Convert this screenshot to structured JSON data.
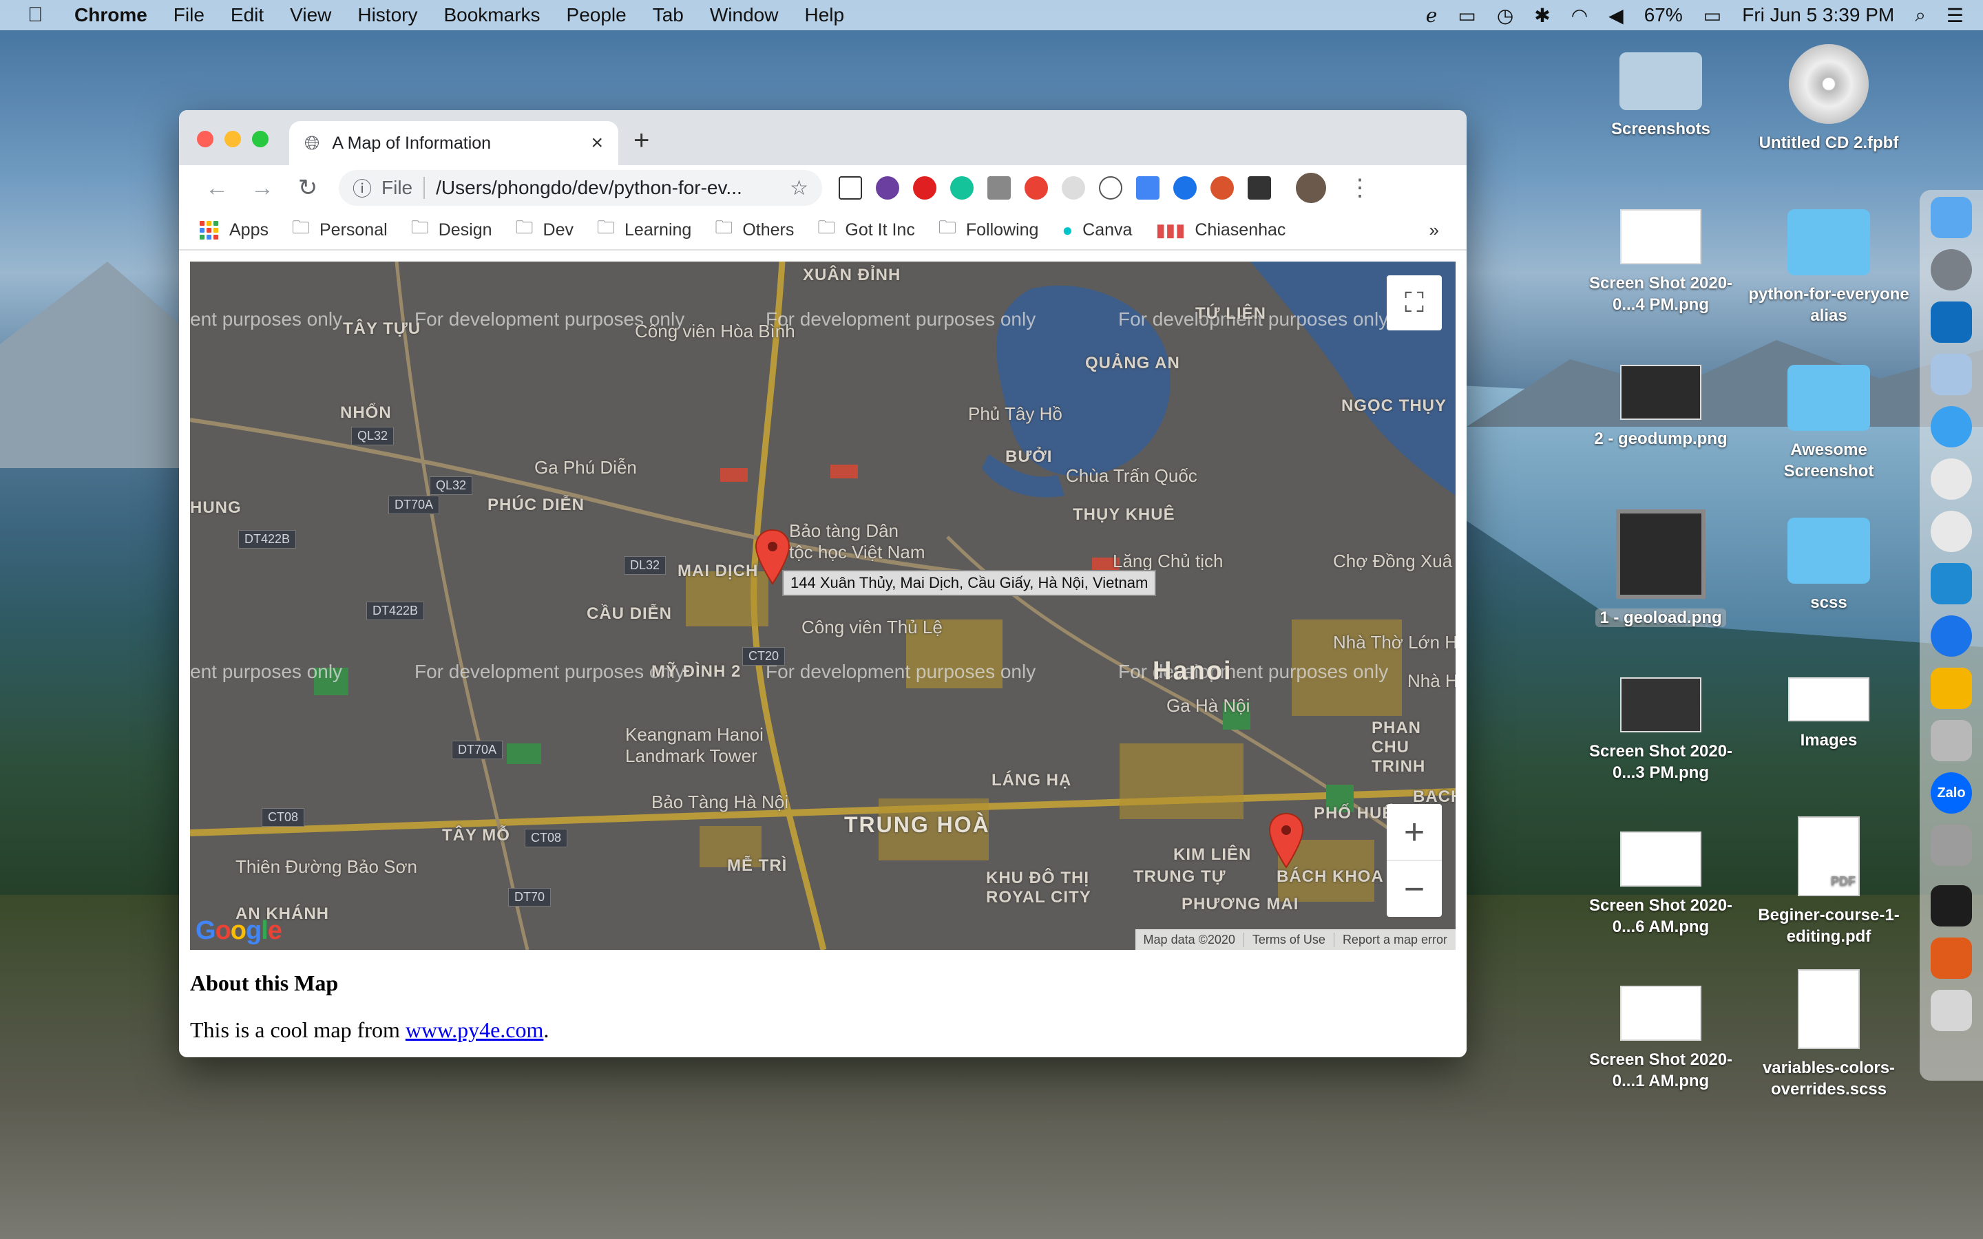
{
  "menubar": {
    "app": "Chrome",
    "items": [
      "File",
      "Edit",
      "View",
      "History",
      "Bookmarks",
      "People",
      "Tab",
      "Window",
      "Help"
    ],
    "battery": "67%",
    "clock": "Fri Jun 5  3:39 PM"
  },
  "browser": {
    "tab_title": "A Map of Information",
    "scheme": "File",
    "url": "/Users/phongdo/dev/python-for-ev...",
    "bookmarks": [
      "Apps",
      "Personal",
      "Design",
      "Dev",
      "Learning",
      "Others",
      "Got It Inc",
      "Following",
      "Canva",
      "Chiasenhac"
    ],
    "more": "»"
  },
  "map": {
    "watermark": "For development purposes only",
    "watermark_partial": "ent purposes only",
    "tooltip": "144 Xuân Thủy, Mai Dịch, Cầu Giấy, Hà Nội, Vietnam",
    "attribution": [
      "Map data ©2020",
      "Terms of Use",
      "Report a map error"
    ],
    "logo": "Google",
    "labels": {
      "hanoi": "Hanoi",
      "xuan_dinh": "XUÂN ĐỈNH",
      "tay_tuu": "TÂY TỰU",
      "tu_lien": "TỨ LIÊN",
      "quang_an": "QUẢNG AN",
      "cong_vien_hoa_binh": "Công viên Hòa Bình",
      "nhon": "NHỔN",
      "ngoc_thuy": "NGỌC THỤY",
      "phu_tay_ho": "Phủ Tây Hồ",
      "buoi": "BƯỞI",
      "ga_phu_dien": "Ga Phú Diễn",
      "chua_tran_quoc": "Chùa Trấn Quốc",
      "hung": "HUNG",
      "phuc_dien": "PHÚC DIỄN",
      "thuy_khue": "THỤY KHUÊ",
      "bao_tang_dan_toc": "Bảo tàng Dân tộc học Việt Nam",
      "lang_chu_tich": "Lăng Chủ tịch",
      "mai_dich": "MAI DỊCH",
      "cho_dong_xuan": "Chợ Đồng Xuâ",
      "cau_dien": "CẦU DIỄN",
      "cong_vien_thu_le": "Công viên Thủ Lệ",
      "nha_tho_lon": "Nhà Thờ Lớn H",
      "my_dinh_2": "MỸ ĐÌNH 2",
      "nha_hat": "Nhà H",
      "ga_ha_noi": "Ga Hà Nội",
      "phan_chu_trinh": "PHAN CHU TRINH",
      "keangnam": "Keangnam Hanoi Landmark Tower",
      "lang_ha": "LÁNG HẠ",
      "bao_tang_ha_noi": "Bảo Tàng Hà Nội",
      "trung_hoa": "TRUNG HOÀ",
      "bach": "BACH",
      "phu_hue": "PHỐ HUẾ",
      "tay_mo": "TÂY MỖ",
      "kim_lien": "KIM LIÊN",
      "thien_duong_bao_son": "Thiên Đường Bảo Sơn",
      "me_tri": "MỄ TRÌ",
      "khu_do_thi_royal": "KHU ĐÔ THỊ ROYAL CITY",
      "trung_tu": "TRUNG TỰ",
      "bach_khoa": "BÁCH KHOA",
      "anh_khanh": "AN KHÁNH",
      "phuong_mai": "PHƯƠNG MAI"
    },
    "shields": [
      "QL32",
      "QL32",
      "DT70A",
      "DT422B",
      "DL32",
      "DT422B",
      "CT20",
      "DT70A",
      "CT08",
      "CT08",
      "DT70"
    ]
  },
  "page": {
    "about_title": "About this Map",
    "about_prefix": "This is a cool map from ",
    "about_link": "www.py4e.com",
    "about_suffix": "."
  },
  "desktop": {
    "icons": [
      {
        "label": "Screenshots"
      },
      {
        "label": "Untitled CD 2.fpbf"
      },
      {
        "label": "Screen Shot 2020-0...4 PM.png"
      },
      {
        "label": "python-for-everyone alias"
      },
      {
        "label": "2 - geodump.png"
      },
      {
        "label": "Awesome Screenshot"
      },
      {
        "label": "1 - geoload.png"
      },
      {
        "label": "scss"
      },
      {
        "label": "Screen Shot 2020-0...3 PM.png"
      },
      {
        "label": "Images"
      },
      {
        "label": "Screen Shot 2020-0...6 AM.png"
      },
      {
        "label": "Beginer-course-1-editing.pdf"
      },
      {
        "label": "Screen Shot 2020-0...1 AM.png"
      },
      {
        "label": "variables-colors-overrides.scss"
      }
    ],
    "cd_text": "CD",
    "pdf_text": "PDF"
  },
  "dock": {
    "zalo": "Zalo"
  },
  "colors": {
    "marker": "#ea4335",
    "link": "#0000ee",
    "map_bg": "#5e5c5a",
    "water": "#3d5d8a",
    "road": "#b89a3a"
  }
}
